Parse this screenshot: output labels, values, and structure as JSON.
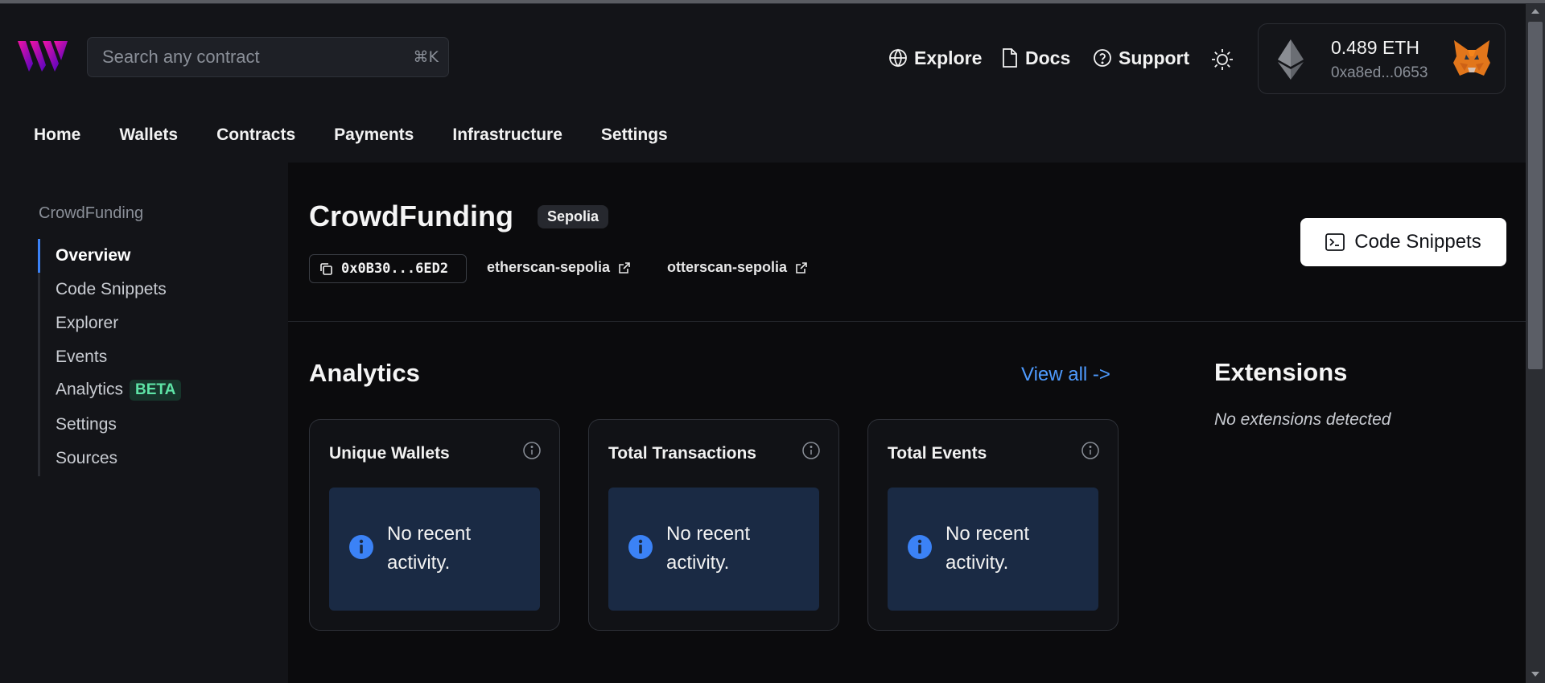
{
  "search": {
    "placeholder": "Search any contract",
    "shortcut": "⌘K"
  },
  "header_links": [
    {
      "label": "Explore",
      "icon": "globe-icon"
    },
    {
      "label": "Docs",
      "icon": "document-icon"
    },
    {
      "label": "Support",
      "icon": "help-circle-icon"
    }
  ],
  "wallet": {
    "balance": "0.489 ETH",
    "address": "0xa8ed...0653"
  },
  "nav": [
    "Home",
    "Wallets",
    "Contracts",
    "Payments",
    "Infrastructure",
    "Settings"
  ],
  "sidebar": {
    "title": "CrowdFunding",
    "items": [
      {
        "label": "Overview",
        "active": true
      },
      {
        "label": "Code Snippets"
      },
      {
        "label": "Explorer"
      },
      {
        "label": "Events"
      },
      {
        "label": "Analytics",
        "badge": "BETA"
      },
      {
        "label": "Settings"
      },
      {
        "label": "Sources"
      }
    ]
  },
  "contract": {
    "name": "CrowdFunding",
    "chain": "Sepolia",
    "address": "0x0B30...6ED2",
    "explorers": [
      "etherscan-sepolia",
      "otterscan-sepolia"
    ],
    "code_snippets_label": "Code Snippets"
  },
  "analytics": {
    "title": "Analytics",
    "view_all": "View all ->",
    "cards": [
      {
        "title": "Unique Wallets",
        "message": "No recent activity."
      },
      {
        "title": "Total Transactions",
        "message": "No recent activity."
      },
      {
        "title": "Total Events",
        "message": "No recent activity."
      }
    ]
  },
  "extensions": {
    "title": "Extensions",
    "empty": "No extensions detected"
  },
  "colors": {
    "accent": "#3b82f6",
    "link": "#4e9bff",
    "background": "#0b0b0d",
    "panel": "#131418",
    "info_box": "#1a2a44",
    "beta_bg": "#17352b",
    "beta_text": "#5ee3a6"
  }
}
